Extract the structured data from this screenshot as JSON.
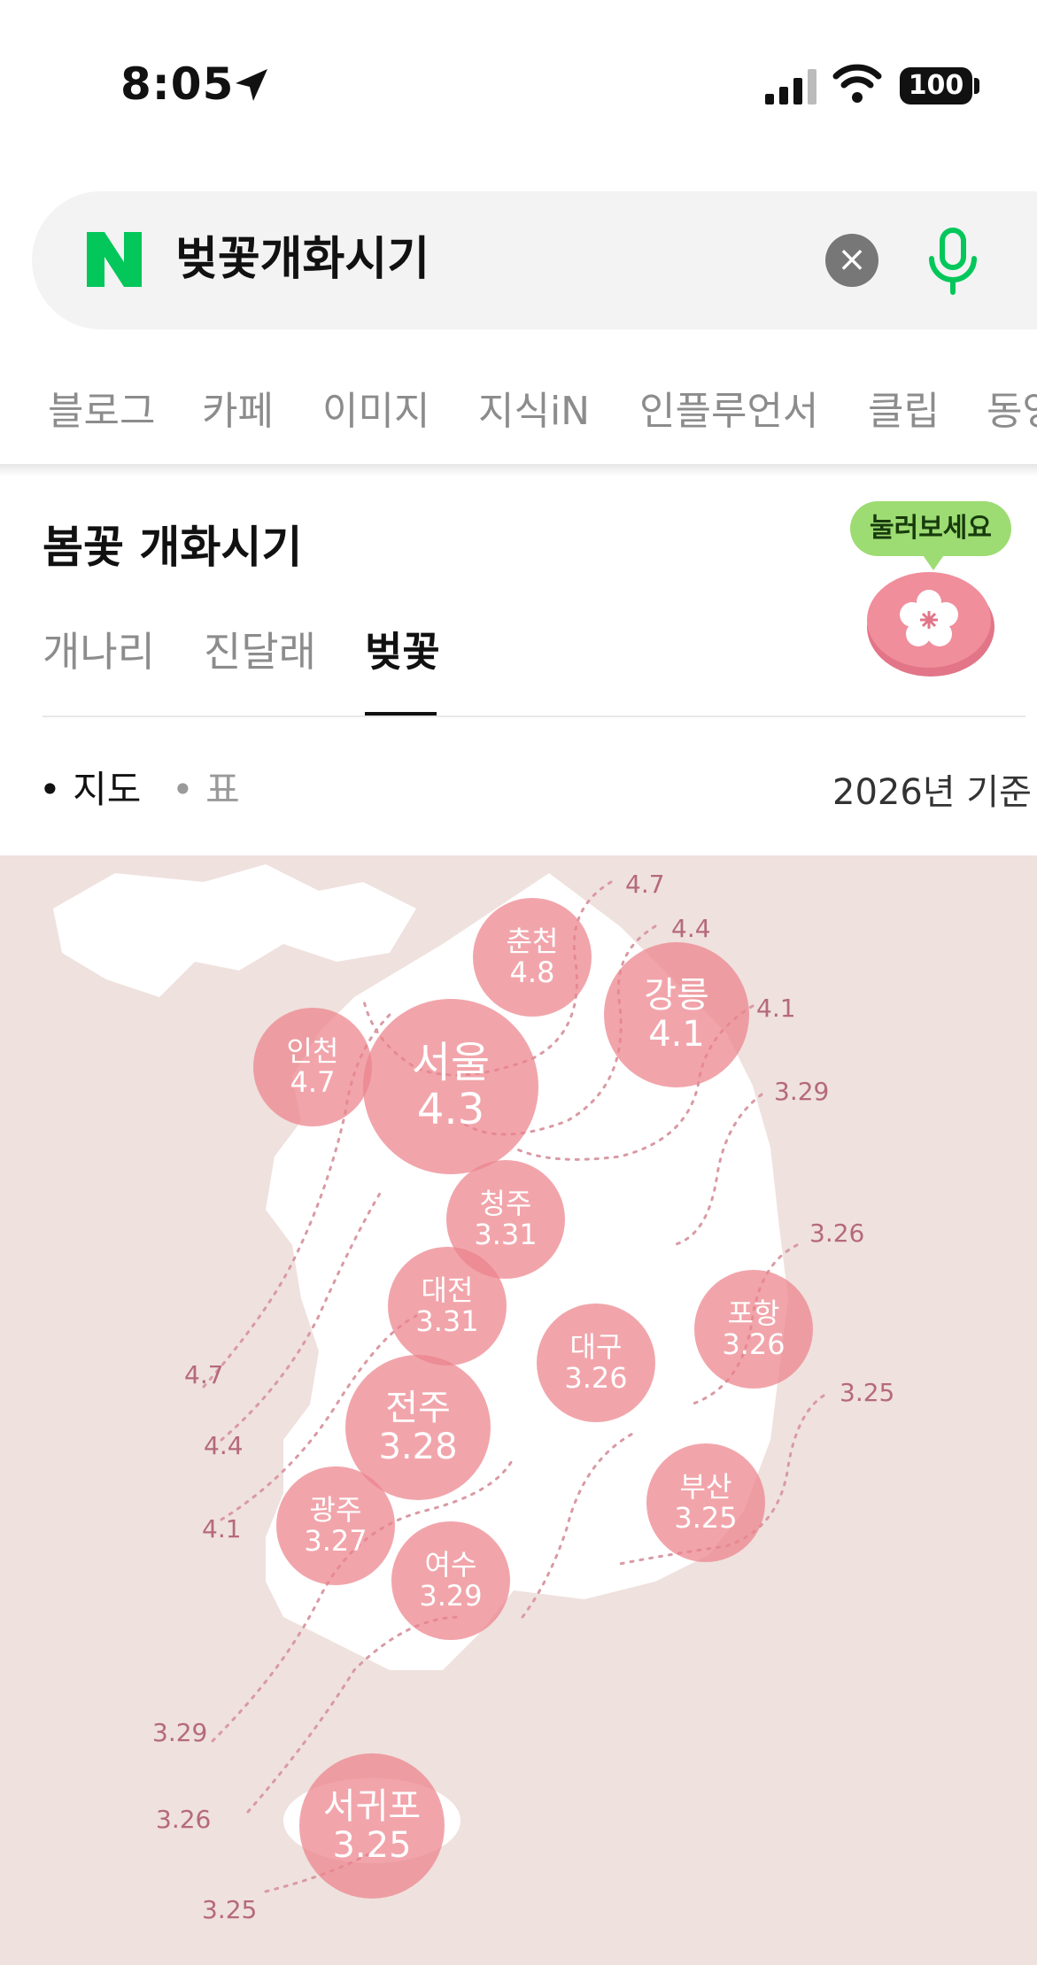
{
  "status_bar": {
    "time": "8:05",
    "battery": "100"
  },
  "search": {
    "query": "벚꽃개화시기",
    "clear_label": "×"
  },
  "category_tabs": [
    "블로그",
    "카페",
    "이미지",
    "지식iN",
    "인플루언서",
    "클립",
    "동영"
  ],
  "card": {
    "title": "봄꽃 개화시기",
    "flower_tabs": [
      "개나리",
      "진달래",
      "벚꽃"
    ],
    "active_flower_tab": "벚꽃",
    "badge": "눌러보세요",
    "view_options": [
      "지도",
      "표"
    ],
    "active_view": "지도",
    "basis": "2026년 기준"
  },
  "map": {
    "cities": [
      {
        "name": "춘천",
        "date": "4.8"
      },
      {
        "name": "강릉",
        "date": "4.1"
      },
      {
        "name": "인천",
        "date": "4.7"
      },
      {
        "name": "서울",
        "date": "4.3"
      },
      {
        "name": "청주",
        "date": "3.31"
      },
      {
        "name": "대전",
        "date": "3.31"
      },
      {
        "name": "대구",
        "date": "3.26"
      },
      {
        "name": "포항",
        "date": "3.26"
      },
      {
        "name": "전주",
        "date": "3.28"
      },
      {
        "name": "광주",
        "date": "3.27"
      },
      {
        "name": "여수",
        "date": "3.29"
      },
      {
        "name": "부산",
        "date": "3.25"
      },
      {
        "name": "서귀포",
        "date": "3.25"
      }
    ],
    "isoline_labels": [
      "4.7",
      "4.4",
      "4.1",
      "3.29",
      "3.26",
      "3.25",
      "4.7",
      "4.4",
      "4.1",
      "3.29",
      "3.26",
      "3.25"
    ]
  },
  "colors": {
    "accent_green": "#03c75a",
    "circle": "#ec828a",
    "map_bg": "#efe1de",
    "isoline": "#b56a79"
  }
}
